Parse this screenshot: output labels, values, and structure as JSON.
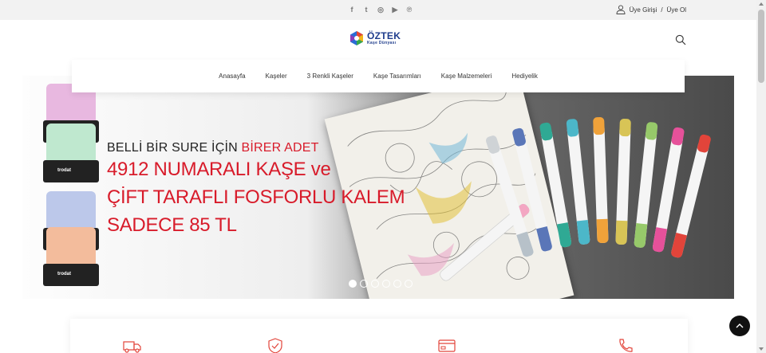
{
  "topbar": {
    "social_icons": [
      "facebook-icon",
      "twitter-icon",
      "instagram-icon",
      "youtube-icon",
      "pinterest-icon"
    ],
    "social_glyphs": [
      "f",
      "t",
      "◎",
      "▶",
      "℗"
    ],
    "login_label": "Üye Girişi",
    "separator": "/",
    "register_label": "Üye Ol"
  },
  "logo": {
    "brand": "ÖZTEK",
    "tagline": "Kaşe Dünyası"
  },
  "nav": {
    "items": [
      "Anasayfa",
      "Kaşeler",
      "3 Renkli Kaşeler",
      "Kaşe Tasarımları",
      "Kaşe Malzemeleri",
      "Hediyelik"
    ]
  },
  "banner": {
    "line1_prefix": "BELLİ BİR SURE İÇİN ",
    "line1_highlight": "BİRER ADET",
    "line2": "4912 NUMARALI KAŞE ve",
    "line3": "ÇİFT TARAFLI FOSFORLU KALEM",
    "line4": "SADECE 85 TL",
    "stamp_brand": "trodat",
    "slide_count": 6,
    "active_slide": 1
  },
  "colors": {
    "accent_red": "#d81b2a",
    "brand_blue": "#1e3c8c",
    "topbar_bg": "#f2f2f2"
  },
  "features": {
    "icons": [
      "truck-icon",
      "shield-check-icon",
      "credit-card-icon",
      "phone-icon"
    ]
  }
}
